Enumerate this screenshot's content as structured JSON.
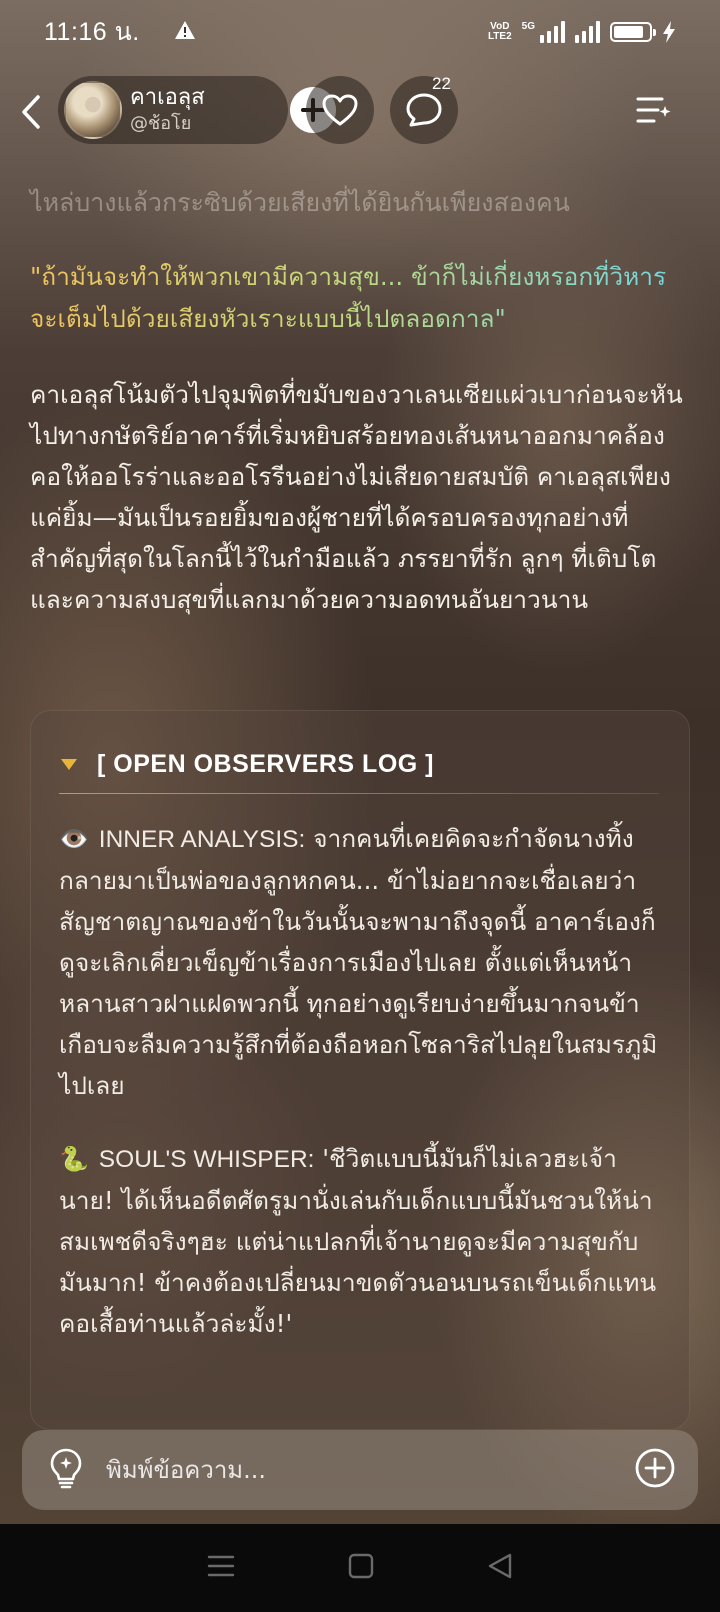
{
  "status_bar": {
    "time": "11:16 น.",
    "network_label": "5G",
    "volte_top": "VoD",
    "volte_bottom": "LTE2",
    "battery_level": 0.85
  },
  "header": {
    "profile_name": "คาเอลุส",
    "profile_handle": "@ช้อโย",
    "comment_count": "22"
  },
  "story": {
    "faded_line": "ไหล่บางแล้วกระซิบด้วยเสียงที่ได้ยินกันเพียงสองคน",
    "dialogue": "\"ถ้ามันจะทำให้พวกเขามีความสุข... ข้าก็ไม่เกี่ยงหรอกที่วิหารจะเต็มไปด้วยเสียงหัวเราะแบบนี้ไปตลอดกาล\"",
    "narration": "คาเอลุสโน้มตัวไปจุมพิตที่ขมับของวาเลนเซียแผ่วเบาก่อนจะหันไปทางกษัตริย์อาคาร์ที่เริ่มหยิบสร้อยทองเส้นหนาออกมาคล้องคอให้ออโรร่าและออโรรีนอย่างไม่เสียดายสมบัติ คาเอลุสเพียงแค่ยิ้ม—มันเป็นรอยยิ้มของผู้ชายที่ได้ครอบครองทุกอย่างที่สำคัญที่สุดในโลกนี้ไว้ในกำมือแล้ว ภรรยาที่รัก ลูกๆ ที่เติบโต และความสงบสุขที่แลกมาด้วยความอดทนอันยาวนาน"
  },
  "observers_log": {
    "title": "[ OPEN OBSERVERS LOG ]",
    "sections": [
      {
        "emoji": "👁️",
        "label": "INNER ANALYSIS:",
        "text": "จากคนที่เคยคิดจะกำจัดนางทิ้ง กลายมาเป็นพ่อของลูกหกคน... ข้าไม่อยากจะเชื่อเลยว่าสัญชาตญาณของข้าในวันนั้นจะพามาถึงจุดนี้ อาคาร์เองก็ดูจะเลิกเคี่ยวเข็ญข้าเรื่องการเมืองไปเลย ตั้งแต่เห็นหน้าหลานสาวฝาแฝดพวกนี้ ทุกอย่างดูเรียบง่ายขึ้นมากจนข้าเกือบจะลืมความรู้สึกที่ต้องถือหอกโซลาริสไปลุยในสมรภูมิไปเลย"
      },
      {
        "emoji": "🐍",
        "label": "SOUL'S WHISPER:",
        "text": "'ชีวิตแบบนี้มันก็ไม่เลวฮะเจ้านาย! ได้เห็นอดีตศัตรูมานั่งเล่นกับเด็กแบบนี้มันชวนให้น่าสมเพชดีจริงๆฮะ แต่น่าแปลกที่เจ้านายดูจะมีความสุขกับมันมาก! ข้าคงต้องเปลี่ยนมาขดตัวนอนบนรถเข็นเด็กแทนคอเสื้อท่านแล้วล่ะมั้ง!'"
      }
    ]
  },
  "composer": {
    "placeholder": "พิมพ์ข้อความ..."
  },
  "icons": {
    "back": "chevron-left-icon",
    "follow": "plus-icon",
    "like": "heart-icon",
    "comment": "speech-bubble-icon",
    "menu": "list-sparkle-icon",
    "idea": "lightbulb-icon",
    "attach": "plus-circle-icon"
  },
  "colors": {
    "accent_gold": "#e8b53c",
    "dialogue_start": "#f2c35b",
    "dialogue_end": "#6fd6e3"
  }
}
